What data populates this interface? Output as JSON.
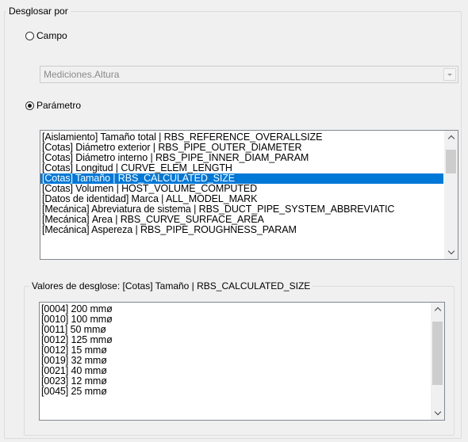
{
  "outer_group": {
    "label": "Desglosar por"
  },
  "campo": {
    "label": "Campo",
    "checked": false,
    "field_value": "Mediciones.Altura"
  },
  "parametro": {
    "label": "Parámetro",
    "checked": true
  },
  "parameters": {
    "items": [
      "[Aislamiento] Tamaño total | RBS_REFERENCE_OVERALLSIZE",
      "[Cotas] Diámetro exterior | RBS_PIPE_OUTER_DIAMETER",
      "[Cotas] Diámetro interno | RBS_PIPE_INNER_DIAM_PARAM",
      "[Cotas] Longitud | CURVE_ELEM_LENGTH",
      "[Cotas] Tamaño | RBS_CALCULATED_SIZE",
      "[Cotas] Volumen | HOST_VOLUME_COMPUTED",
      "[Datos de identidad] Marca | ALL_MODEL_MARK",
      "[Mecánica] Abreviatura de sistema | RBS_DUCT_PIPE_SYSTEM_ABBREVIATIC",
      "[Mecánica] Área | RBS_CURVE_SURFACE_AREA",
      "[Mecánica] Aspereza | RBS_PIPE_ROUGHNESS_PARAM"
    ],
    "selected_index": 4
  },
  "values_group": {
    "label": "Valores de desglose: [Cotas] Tamaño | RBS_CALCULATED_SIZE"
  },
  "values": {
    "items": [
      "[0004] 200 mmø",
      "[0010] 100 mmø",
      "[0011] 50 mmø",
      "[0012] 125 mmø",
      "[0012] 15 mmø",
      "[0019] 32 mmø",
      "[0021] 40 mmø",
      "[0023] 12 mmø",
      "[0045] 25 mmø"
    ]
  },
  "colors": {
    "selection": "#0078d7",
    "background": "#f0f0f0"
  }
}
